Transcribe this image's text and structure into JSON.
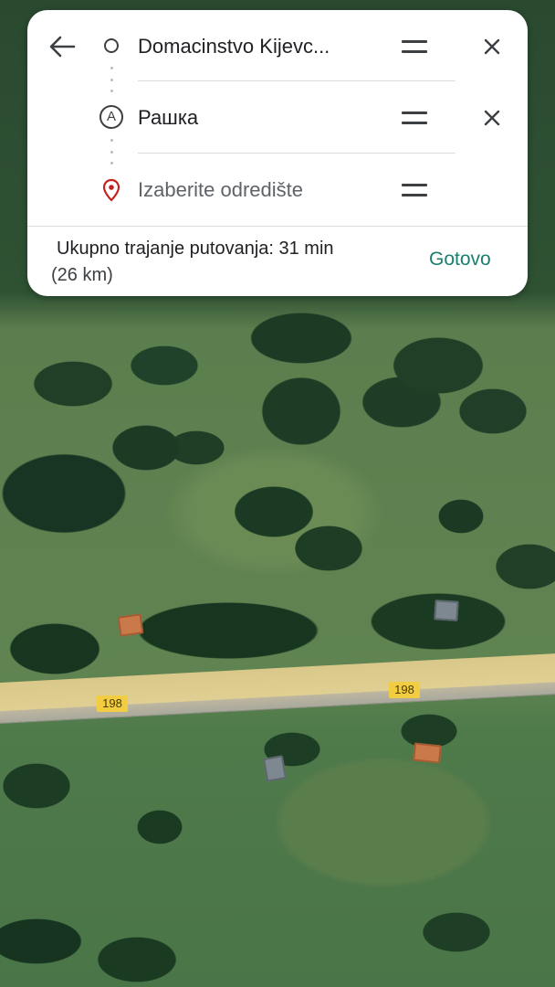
{
  "directions": {
    "back_icon": "arrow-left-icon",
    "origin": {
      "icon": "origin-circle-icon",
      "value": "Domacinstvo Kijevc..."
    },
    "stop_a": {
      "icon_letter": "A",
      "value": "Рашка"
    },
    "destination": {
      "icon": "location-pin-icon",
      "placeholder": "Izaberite odredište"
    },
    "drag_icon": "drag-handle-icon",
    "remove_icon": "close-icon"
  },
  "summary": {
    "total_label": "Ukupno trajanje putovanja: 31 min",
    "distance": "(26 km)",
    "done_label": "Gotovo"
  },
  "map": {
    "road_labels": [
      "198",
      "198"
    ]
  },
  "colors": {
    "accent": "#1a7f6e",
    "pin": "#c5221f",
    "road_shield": "#f3cd41"
  }
}
